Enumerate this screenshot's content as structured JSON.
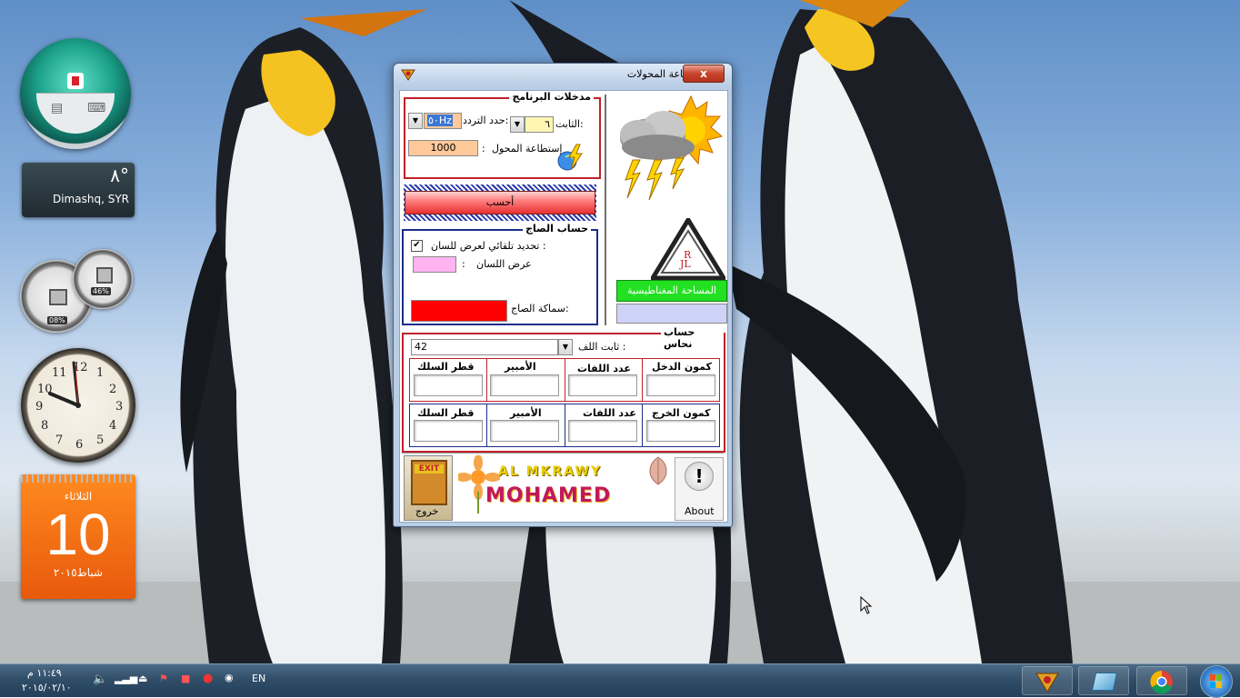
{
  "gadgets": {
    "weather": {
      "temp": "٨°",
      "city": "Dimashq, SYR"
    },
    "cpu": {
      "cpu_pct": "08%",
      "mem_pct": "46%"
    },
    "clock": {
      "numbers": [
        "12",
        "1",
        "2",
        "3",
        "4",
        "5",
        "6",
        "7",
        "8",
        "9",
        "10",
        "11"
      ]
    },
    "calendar": {
      "weekday": "الثلاثاء",
      "day": "10",
      "month_year": "شباط٢٠١٥"
    }
  },
  "window": {
    "title": "قانون صناعة المحولات",
    "close_label": "x",
    "inputs_section": {
      "legend": "مدخلات البرنامج",
      "freq_label": "حدد التردد:",
      "freq_value": "٥٠Hz",
      "constant_label": "الثابت:",
      "constant_value": "٦",
      "power_label": "إستطاعة المحول",
      "power_value": "1000",
      "colon": ":"
    },
    "calc_button": "أحسب",
    "sheet_section": {
      "legend": "حساب الصاج",
      "auto_label": "تحديد تلقائي لعرض للسان :",
      "auto_checked": true,
      "tongue_width_label": "عرض اللسان",
      "colon": ":",
      "thickness_label": "سماكة الصاج:"
    },
    "magnetic_area_label": "المساحة المغناطيسية",
    "copper_section": {
      "legend": "حساب نحاس",
      "coil_constant_label": "ثابت اللف :",
      "coil_constant_value": "42",
      "input_row": {
        "headers": [
          "كمون الدخل",
          "عدد اللفات",
          "الأمبير",
          "قطر السلك"
        ]
      },
      "output_row": {
        "headers": [
          "كمون الخرج",
          "عدد اللفات",
          "الأمبير",
          "قطر السلك"
        ]
      }
    },
    "exit_sign": "EXIT",
    "exit_label": "خروج",
    "banner_top": "AL MKRAWY",
    "banner_bottom": "MOHAMED",
    "about_label": "About"
  },
  "taskbar": {
    "time": "١١:٤٩ م",
    "date": "٢٠١٥/٠٢/١٠",
    "language": "EN"
  },
  "colors": {
    "section_border": "#c0212a",
    "sheet_border": "#1a2e8a",
    "power_field": "#ffc99a",
    "constant_field": "#fff6b3",
    "tongue_field": "#ffb3f0",
    "thickness_field": "#ff0000",
    "magnetic_label_bg": "#22e022",
    "magnetic_field": "#cdd3f7"
  }
}
